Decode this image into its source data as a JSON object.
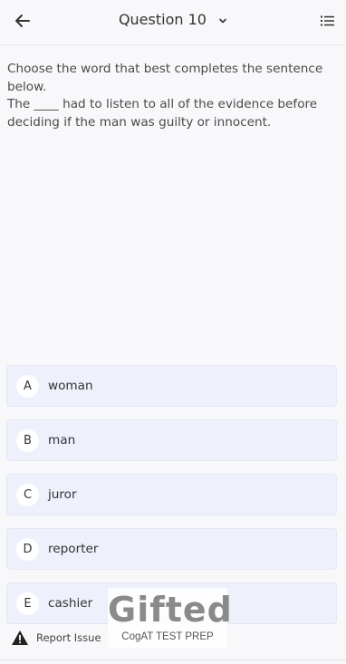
{
  "header": {
    "title": "Question 10",
    "back_icon": "arrow-left-icon",
    "title_dropdown_icon": "chevron-down-icon",
    "list_icon": "list-icon"
  },
  "question": {
    "instruction": "Choose the word that best completes the sentence below.",
    "sentence": "The ____ had to listen to all of the evidence before deciding if the man was guilty or innocent."
  },
  "answers": [
    {
      "letter": "A",
      "text": "woman"
    },
    {
      "letter": "B",
      "text": "man"
    },
    {
      "letter": "C",
      "text": "juror"
    },
    {
      "letter": "D",
      "text": "reporter"
    },
    {
      "letter": "E",
      "text": "cashier"
    }
  ],
  "footer": {
    "report_label": "Report Issue",
    "report_icon": "warning-icon"
  },
  "watermark": {
    "logo": "Gifted",
    "subtitle": "CogAT TEST PREP"
  },
  "colors": {
    "background": "#f8f8fb",
    "answer_background": "#eef0fb",
    "text": "#333333"
  }
}
